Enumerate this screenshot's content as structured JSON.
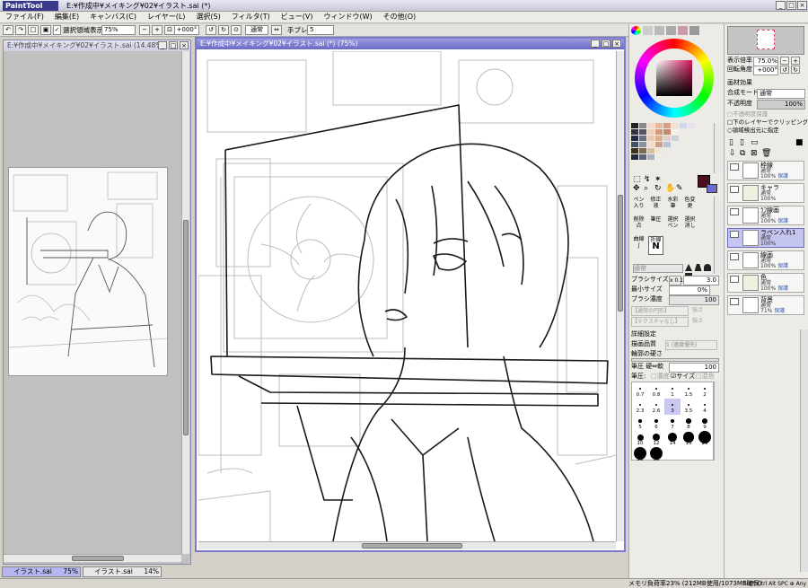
{
  "app": {
    "logo": "PaintTool SAI",
    "title": "E:¥作成中¥メイキング¥02¥イラスト.sai (*)"
  },
  "menu": [
    "ファイル(F)",
    "編集(E)",
    "キャンバス(C)",
    "レイヤー(L)",
    "選択(S)",
    "フィルタ(T)",
    "ビュー(V)",
    "ウィンドウ(W)",
    "その他(O)"
  ],
  "toolbar": {
    "show_selection": "選択領域表示",
    "zoom": "75%",
    "angle": "+000°",
    "blend": "通常",
    "stabilizer_label": "手ブレ補正",
    "stabilizer_value": "5"
  },
  "windows": {
    "left": {
      "title": "E:¥作成中¥メイキング¥02¥イラスト.sai (14.48%)"
    },
    "main": {
      "title": "E:¥作成中¥メイキング¥02¥イラスト.sai (*) (75%)"
    }
  },
  "tabs": [
    {
      "label": "イラスト.sai",
      "zoom": "75%"
    },
    {
      "label": "イラスト.sai",
      "zoom": "14%"
    }
  ],
  "status": {
    "memory": "メモリ負荷率23% (212MB使用/1073MB確保)",
    "keys": "Shift Ctrl Alt SPC ⊕ Any"
  },
  "brush_tools": [
    {
      "name": "ペン",
      "sub": "入り"
    },
    {
      "name": "修正液",
      "sub": ""
    },
    {
      "name": "水彩筆",
      "sub": ""
    },
    {
      "name": "色変更",
      "sub": ""
    },
    {
      "name": "削除点",
      "sub": ""
    },
    {
      "name": "筆圧",
      "sub": ""
    },
    {
      "name": "選択ペン",
      "sub": ""
    },
    {
      "name": "選択消し",
      "sub": ""
    },
    {
      "name": "曲線",
      "sub": ""
    },
    {
      "name": "折線",
      "sub": "N"
    }
  ],
  "brush": {
    "mode": "通常",
    "size_label": "ブラシサイズ",
    "size_mult": "x 0.1",
    "size_value": "3.0",
    "min_size_label": "最小サイズ",
    "min_size_value": "0%",
    "density_label": "ブラシ濃度",
    "density_value": "100",
    "texture": "【通常の円形】",
    "texture_strength": "強さ",
    "blur": "【テクスチャなし】",
    "blur_strength": "強さ",
    "detail_label": "詳細設定",
    "quality_label": "描画品質",
    "quality_value": "1 (速度優先)",
    "edge_label": "輪郭の硬さ",
    "pressure_hard_label": "筆圧 硬⇔軟",
    "pressure_hard_value": "100",
    "pressure_label": "筆圧:",
    "pressure_opts": [
      "濃度",
      "サイズ",
      "混色"
    ]
  },
  "brush_sizes": [
    "0.7",
    "0.8",
    "1",
    "1.5",
    "2",
    "2.3",
    "2.6",
    "3",
    "3.5",
    "4",
    "5",
    "6",
    "7",
    "8",
    "9",
    "10",
    "12",
    "14",
    "16",
    "20",
    "25",
    "30"
  ],
  "navigator": {
    "zoom_label": "表示倍率",
    "zoom_value": "75.0%",
    "angle_label": "回転角度",
    "angle_value": "+000°"
  },
  "layer_props": {
    "effects_label": "画材効果",
    "blend_label": "合成モード",
    "blend_value": "通常",
    "opacity_label": "不透明度",
    "opacity_value": "100%",
    "protect": "不透明度保護",
    "clip": "下のレイヤーでクリッピング",
    "select_source": "領域検出元に指定"
  },
  "layers": [
    {
      "name": "枠線",
      "mode": "通常",
      "opacity": "100%",
      "extra": "保護",
      "folder": false,
      "selected": false
    },
    {
      "name": "キャラ",
      "mode": "通常",
      "opacity": "100%",
      "extra": "",
      "folder": true,
      "selected": false
    },
    {
      "name": "ﾗﾌ線画",
      "mode": "通常",
      "opacity": "100%",
      "extra": "保護",
      "folder": false,
      "selected": false
    },
    {
      "name": "ラペン入れ1",
      "mode": "通常",
      "opacity": "100%",
      "extra": "",
      "folder": false,
      "selected": true
    },
    {
      "name": "線画",
      "mode": "通常",
      "opacity": "100%",
      "extra": "保護",
      "folder": false,
      "selected": false
    },
    {
      "name": "色",
      "mode": "通常",
      "opacity": "100%",
      "extra": "保護",
      "folder": true,
      "selected": false
    },
    {
      "name": "背景",
      "mode": "通常",
      "opacity": "71%",
      "extra": "保護",
      "folder": false,
      "selected": false
    }
  ],
  "colors": {
    "accent": "#7a7ad0",
    "main_color": "#4a1022"
  }
}
